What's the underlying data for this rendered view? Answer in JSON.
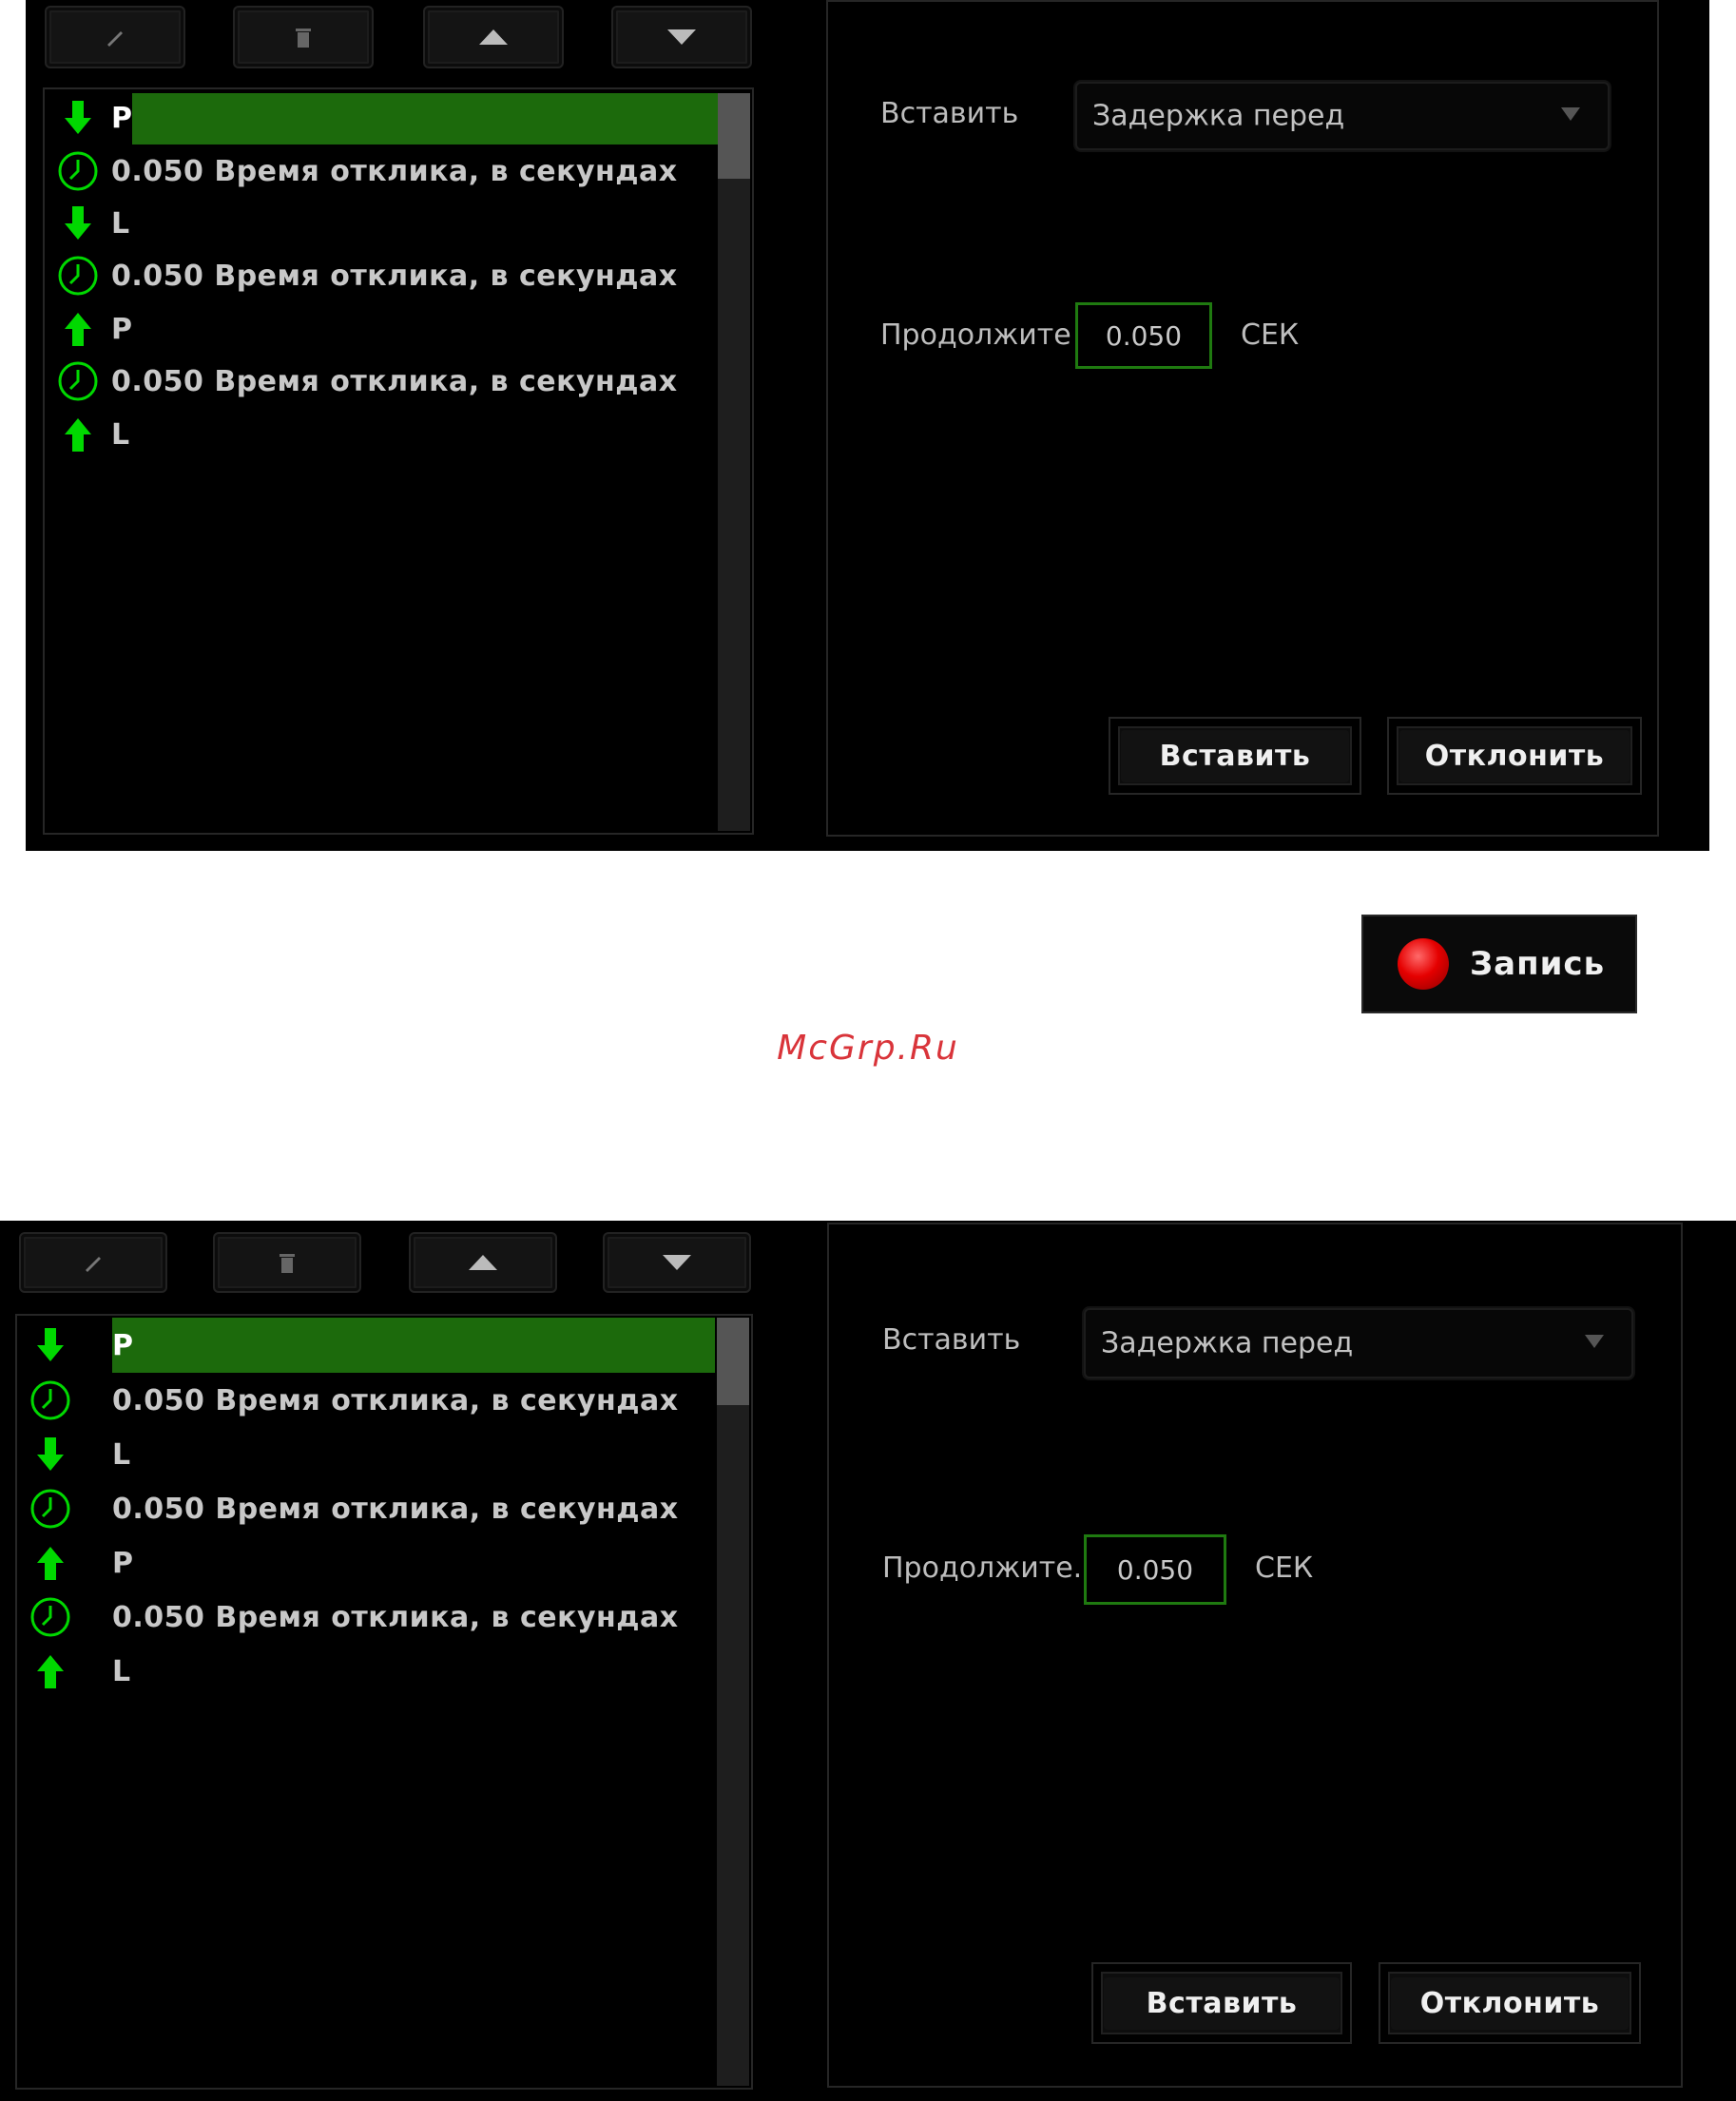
{
  "toolbar": {
    "buttons": [
      {
        "name": "edit",
        "icon": "pencil-icon"
      },
      {
        "name": "delete",
        "icon": "trash-icon"
      },
      {
        "name": "move-up",
        "icon": "arrow-up-icon"
      },
      {
        "name": "move-down",
        "icon": "arrow-down-icon"
      }
    ]
  },
  "macro_list": {
    "items": [
      {
        "icon": "key-down-arrow-icon",
        "text": "P",
        "selected": true
      },
      {
        "icon": "clock-icon",
        "text": "0.050 Время отклика, в секундах",
        "selected": false
      },
      {
        "icon": "key-down-arrow-icon",
        "text": "L",
        "selected": false
      },
      {
        "icon": "clock-icon",
        "text": "0.050 Время отклика, в секундах",
        "selected": false
      },
      {
        "icon": "key-up-arrow-icon",
        "text": "P",
        "selected": false
      },
      {
        "icon": "clock-icon",
        "text": "0.050 Время отклика, в секундах",
        "selected": false
      },
      {
        "icon": "key-up-arrow-icon",
        "text": "L",
        "selected": false
      }
    ]
  },
  "settings": {
    "insert_label": "Вставить",
    "insert_dropdown_value": "Задержка перед",
    "duration_label": "Продолжите.",
    "duration_value": "0.050",
    "duration_unit": "СЕК",
    "insert_button": "Вставить",
    "cancel_button": "Отклонить"
  },
  "record_button": {
    "label": "Запись"
  },
  "watermark": "McGrp.Ru",
  "colors": {
    "selection": "#1c6a0c",
    "accent_green": "#00e000",
    "record_red": "#e50000",
    "watermark": "#d9343a"
  }
}
